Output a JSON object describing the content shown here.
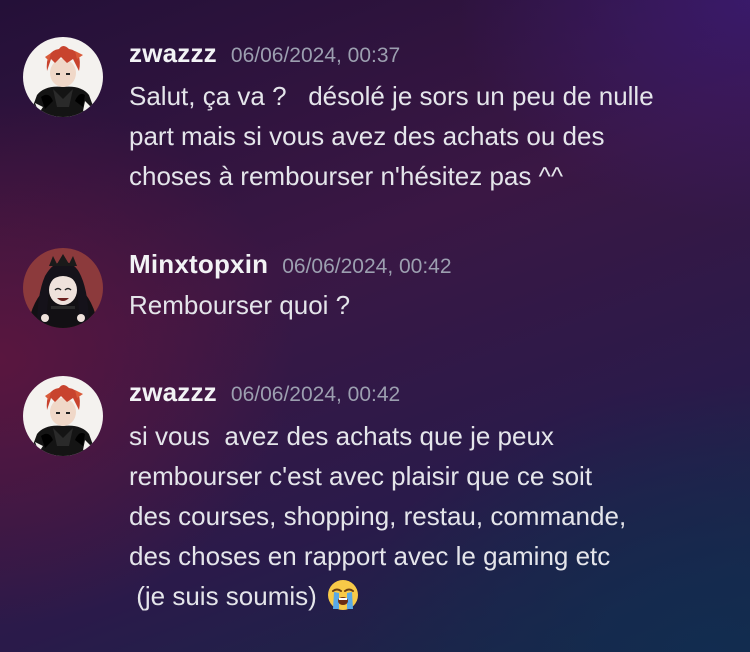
{
  "messages": [
    {
      "author": "zwazzz",
      "timestamp": "06/06/2024, 00:37",
      "avatar_icon": "anime-avatar-red-hair-icon",
      "lines": [
        "Salut, ça va ?   désolé je sors un peu de nulle",
        "part mais si vous avez des achats ou des",
        "choses à rembourser n'hésitez pas ^^"
      ]
    },
    {
      "author": "Minxtopxin",
      "timestamp": "06/06/2024, 00:42",
      "avatar_icon": "anime-avatar-dark-hair-crown-icon",
      "lines": [
        "Rembourser quoi ?"
      ]
    },
    {
      "author": "zwazzz",
      "timestamp": "06/06/2024, 00:42",
      "avatar_icon": "anime-avatar-red-hair-icon",
      "lines": [
        "si vous  avez des achats que je peux",
        "rembourser c'est avec plaisir que ce soit",
        "des courses, shopping, restau, commande,",
        "des choses en rapport avec le gaming etc",
        " (je suis soumis)"
      ],
      "trailing_emoji": "loudly-crying-face-emoji"
    }
  ],
  "colors": {
    "username": "#f2f3f5",
    "timestamp": "#9c9fb0",
    "message_text": "#e4e5ea"
  }
}
